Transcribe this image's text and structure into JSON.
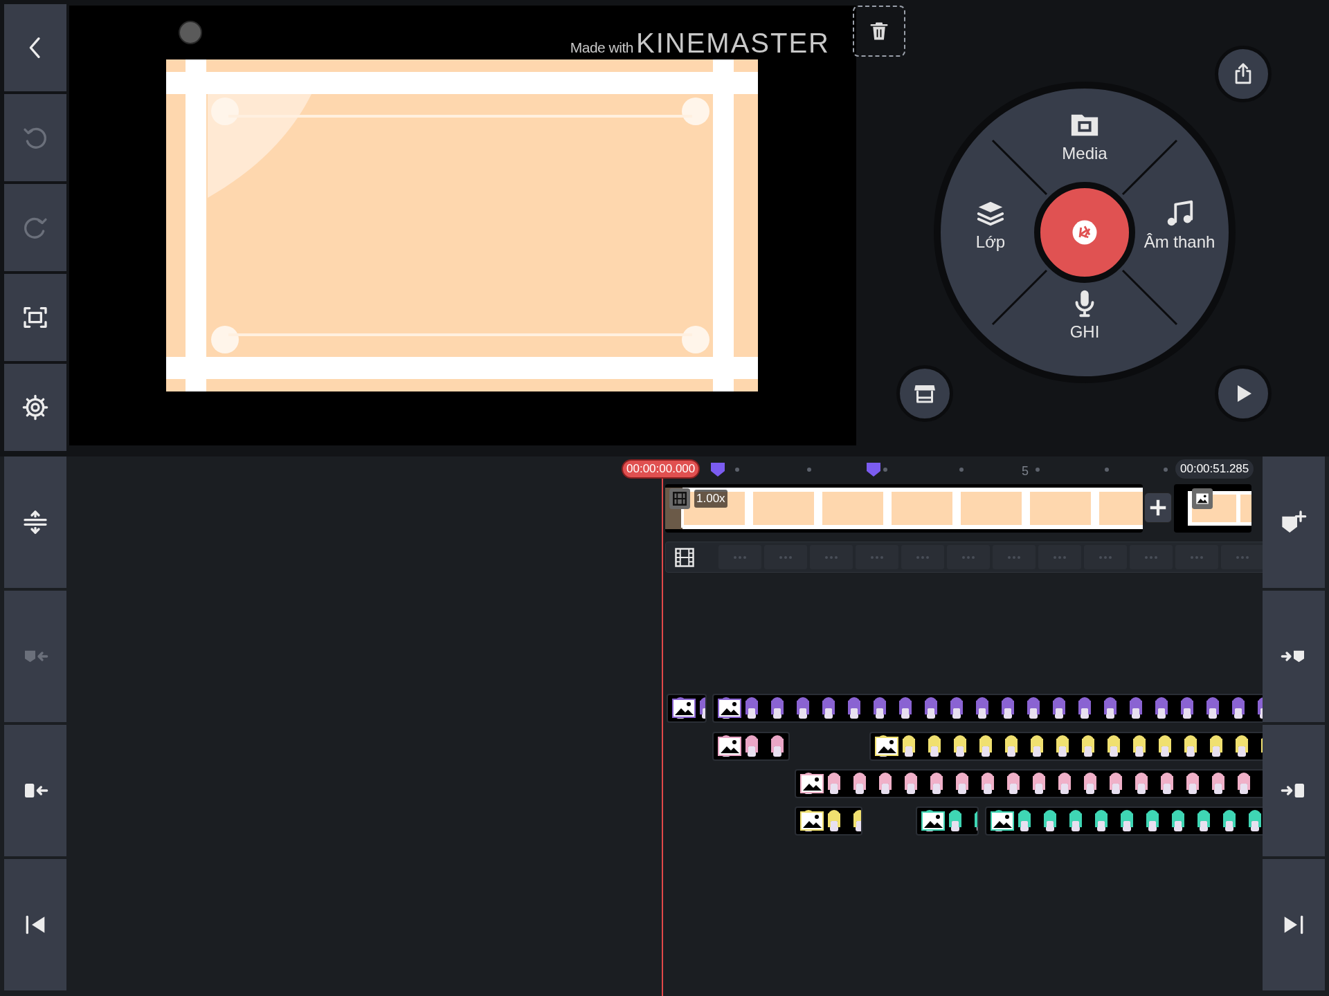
{
  "left_toolbar": [
    {
      "kind": "back",
      "disabled": false
    },
    {
      "kind": "undo",
      "disabled": true
    },
    {
      "kind": "redo",
      "disabled": true
    },
    {
      "kind": "fullscreen",
      "disabled": false
    },
    {
      "kind": "settings",
      "disabled": false
    }
  ],
  "preview": {
    "watermark": "Made with",
    "brand": "**KINE**MASTER"
  },
  "media_wheel": [
    {
      "kind": "media",
      "label": "Media"
    },
    {
      "kind": "layer",
      "label": "Lớp"
    },
    {
      "kind": "audio",
      "label": "Âm thanh"
    },
    {
      "kind": "record",
      "label": "GHI"
    }
  ],
  "timeline": {
    "playhead_time": "00:00:00.000",
    "ruler_label": "5",
    "end_time": "00:00:51.285",
    "main_clip": {
      "speed": "1.00x"
    },
    "layers": [
      [
        {
          "color": "#8a63d2"
        },
        {
          "color": "#8a63d2"
        }
      ],
      [
        {
          "color": "#eaa6c6"
        },
        {
          "color": "#f0e070"
        }
      ],
      [
        {
          "color": "#f0b0c8"
        }
      ],
      [
        {
          "color": "#f0e070"
        },
        {
          "color": "#3fd6b4"
        },
        {
          "color": "#3fd6b4"
        }
      ]
    ]
  },
  "timeline_left_tools": [
    {
      "kind": "expand",
      "disabled": false
    },
    {
      "kind": "marker_left",
      "disabled": true
    },
    {
      "kind": "trim_left",
      "disabled": false
    },
    {
      "kind": "skip_start",
      "disabled": false
    }
  ],
  "timeline_right_tools": [
    {
      "kind": "add_marker",
      "disabled": false
    },
    {
      "kind": "marker_right",
      "disabled": false
    },
    {
      "kind": "trim_right",
      "disabled": false
    },
    {
      "kind": "skip_end",
      "disabled": false
    }
  ]
}
